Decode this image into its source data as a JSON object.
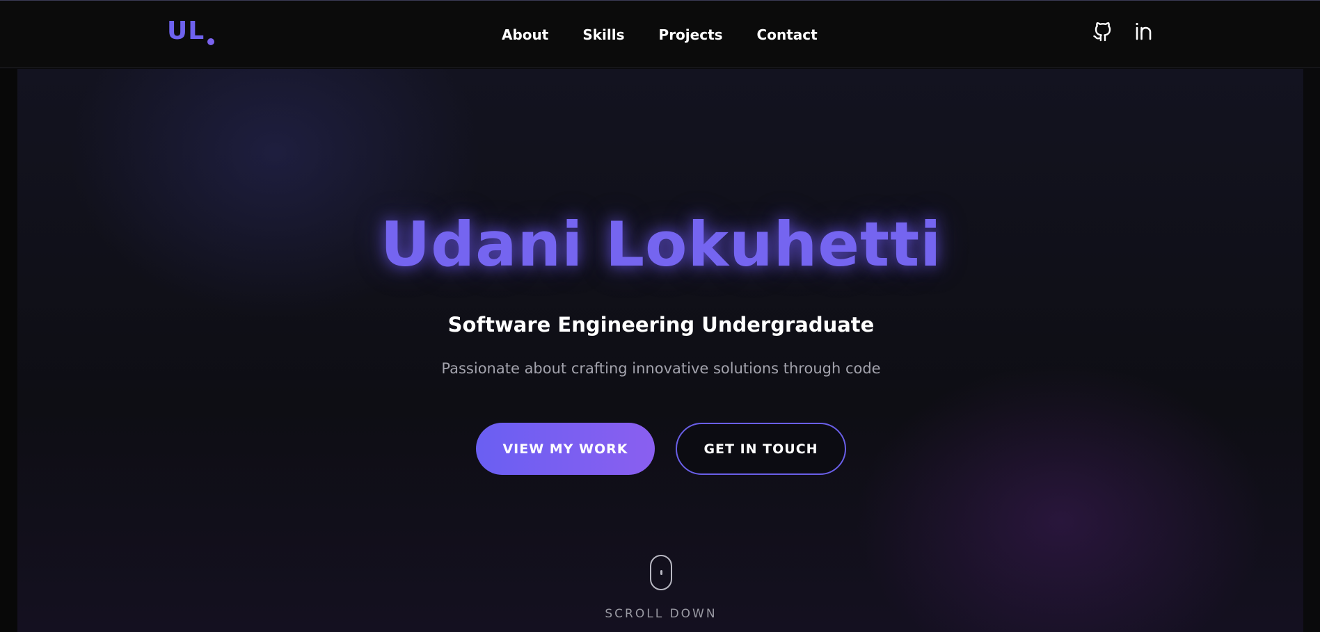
{
  "nav": {
    "logo": "UL",
    "links": [
      "About",
      "Skills",
      "Projects",
      "Contact"
    ],
    "socials": [
      "github-icon",
      "linkedin-icon"
    ]
  },
  "hero": {
    "name": "Udani Lokuhetti",
    "role": "Software Engineering Undergraduate",
    "tagline": "Passionate about crafting innovative solutions through code",
    "primary_button": "VIEW MY WORK",
    "secondary_button": "GET IN TOUCH",
    "scroll_label": "SCROLL DOWN"
  },
  "colors": {
    "accent": "#6e62ee",
    "accent_end": "#8a5ff0",
    "background": "#0a0a0c"
  }
}
